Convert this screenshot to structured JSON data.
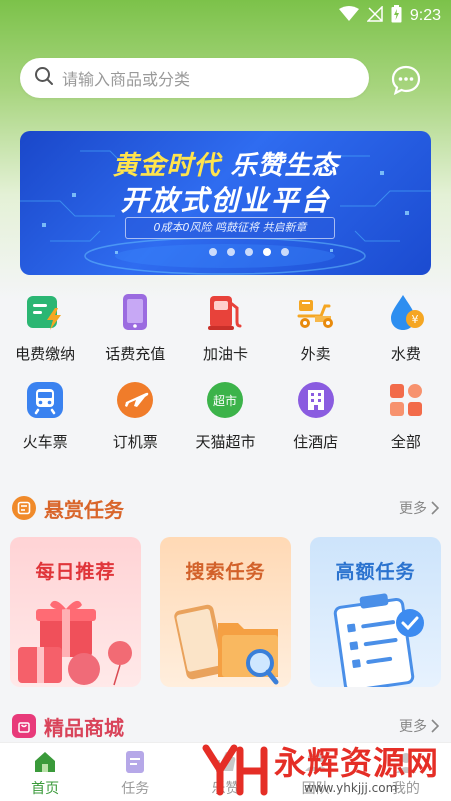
{
  "status_bar": {
    "time": "9:23"
  },
  "search": {
    "placeholder": "请输入商品或分类"
  },
  "banner": {
    "title_part1": "黄金时代",
    "title_part2": "乐赞生态",
    "subtitle": "开放式创业平台",
    "tagline": "0成本0风险  鸣鼓征将 共启新章",
    "dots": 5,
    "active_dot": 4
  },
  "menu": {
    "row1": [
      {
        "label": "电费缴纳",
        "icon": "electricity-bill-icon",
        "color": "#2bb673"
      },
      {
        "label": "话费充值",
        "icon": "phone-recharge-icon",
        "color": "#9b6be0"
      },
      {
        "label": "加油卡",
        "icon": "fuel-pump-icon",
        "color": "#e8423a"
      },
      {
        "label": "外卖",
        "icon": "delivery-scooter-icon",
        "color": "#f5a623"
      },
      {
        "label": "水费",
        "icon": "water-drop-icon",
        "color": "#2d8ef0"
      }
    ],
    "row2": [
      {
        "label": "火车票",
        "icon": "train-icon",
        "color": "#3a82f0"
      },
      {
        "label": "订机票",
        "icon": "airplane-icon",
        "color": "#f07c2a"
      },
      {
        "label": "天猫超市",
        "icon": "tmall-supermarket-icon",
        "color": "#3cb34a",
        "badge": "超市"
      },
      {
        "label": "住酒店",
        "icon": "hotel-icon",
        "color": "#8a5ce0"
      },
      {
        "label": "全部",
        "icon": "all-grid-icon",
        "color": "#f26b4a"
      }
    ]
  },
  "reward_section": {
    "title": "悬赏任务",
    "more": "更多"
  },
  "task_cards": [
    {
      "title": "每日推荐"
    },
    {
      "title": "搜索任务"
    },
    {
      "title": "高额任务"
    }
  ],
  "mall_section": {
    "title": "精品商城",
    "more": "更多"
  },
  "bottom_nav": [
    {
      "label": "首页",
      "active": true
    },
    {
      "label": "任务",
      "active": false
    },
    {
      "label": "乐赞",
      "active": false
    },
    {
      "label": "团队",
      "active": false
    },
    {
      "label": "我的",
      "active": false
    }
  ],
  "watermark": {
    "text": "永辉资源网",
    "url": "www.yhkjjj.com"
  }
}
